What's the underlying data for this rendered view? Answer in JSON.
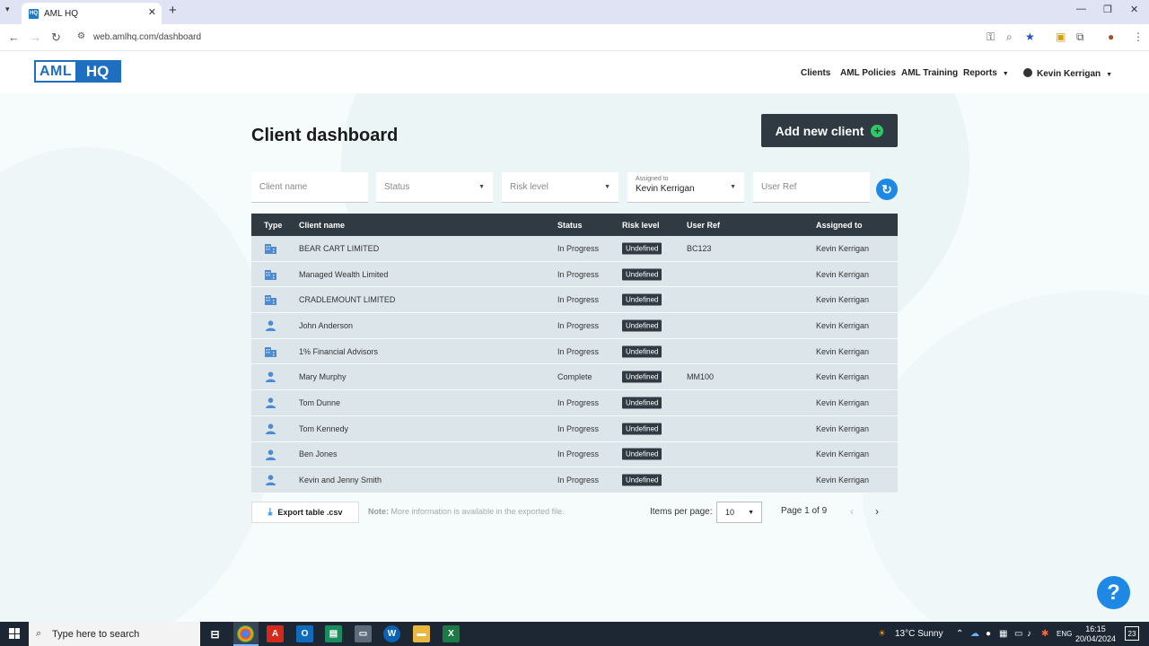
{
  "browser": {
    "tab_title": "AML HQ",
    "favicon_text": "HQ",
    "url": "web.amlhq.com/dashboard"
  },
  "header": {
    "logo_left": "AML",
    "logo_right": "HQ",
    "nav": [
      "Clients",
      "AML Policies",
      "AML Training",
      "Reports"
    ],
    "user": "Kevin Kerrigan"
  },
  "page": {
    "title": "Client dashboard",
    "add_button": "Add new client"
  },
  "filters": {
    "client_name_placeholder": "Client name",
    "status_placeholder": "Status",
    "risk_placeholder": "Risk level",
    "assigned_label": "Assigned to",
    "assigned_value": "Kevin Kerrigan",
    "user_ref_placeholder": "User Ref"
  },
  "table": {
    "headers": [
      "Type",
      "Client name",
      "Status",
      "Risk level",
      "User Ref",
      "Assigned to"
    ],
    "rows": [
      {
        "type": "company",
        "name": "BEAR CART LIMITED",
        "status": "In Progress",
        "risk": "Undefined",
        "ref": "BC123",
        "assigned": "Kevin Kerrigan"
      },
      {
        "type": "company",
        "name": "Managed Wealth Limited",
        "status": "In Progress",
        "risk": "Undefined",
        "ref": "",
        "assigned": "Kevin Kerrigan"
      },
      {
        "type": "company",
        "name": "CRADLEMOUNT LIMITED",
        "status": "In Progress",
        "risk": "Undefined",
        "ref": "",
        "assigned": "Kevin Kerrigan"
      },
      {
        "type": "person",
        "name": "John Anderson",
        "status": "In Progress",
        "risk": "Undefined",
        "ref": "",
        "assigned": "Kevin Kerrigan"
      },
      {
        "type": "company",
        "name": "1% Financial Advisors",
        "status": "In Progress",
        "risk": "Undefined",
        "ref": "",
        "assigned": "Kevin Kerrigan"
      },
      {
        "type": "person",
        "name": "Mary Murphy",
        "status": "Complete",
        "risk": "Undefined",
        "ref": "MM100",
        "assigned": "Kevin Kerrigan"
      },
      {
        "type": "person",
        "name": "Tom Dunne",
        "status": "In Progress",
        "risk": "Undefined",
        "ref": "",
        "assigned": "Kevin Kerrigan"
      },
      {
        "type": "person",
        "name": "Tom Kennedy",
        "status": "In Progress",
        "risk": "Undefined",
        "ref": "",
        "assigned": "Kevin Kerrigan"
      },
      {
        "type": "person",
        "name": "Ben Jones",
        "status": "In Progress",
        "risk": "Undefined",
        "ref": "",
        "assigned": "Kevin Kerrigan"
      },
      {
        "type": "person",
        "name": "Kevin and Jenny Smith",
        "status": "In Progress",
        "risk": "Undefined",
        "ref": "",
        "assigned": "Kevin Kerrigan"
      }
    ]
  },
  "footer": {
    "export_label": "Export table .csv",
    "note_label": "Note:",
    "note_text": "More information is available in the exported file.",
    "items_per_page_label": "Items per page:",
    "items_per_page_value": "10",
    "page_info": "Page 1 of 9"
  },
  "help": {
    "label": "?"
  },
  "taskbar": {
    "search_placeholder": "Type here to search",
    "weather": "13°C  Sunny",
    "lang": "ENG",
    "time": "16:15",
    "date": "20/04/2024",
    "notifications": "23"
  },
  "colors": {
    "brand_blue": "#1f6fc0",
    "dark": "#2f3a42",
    "accent_blue": "#1e88e5",
    "row_bg": "#dce6ea"
  }
}
